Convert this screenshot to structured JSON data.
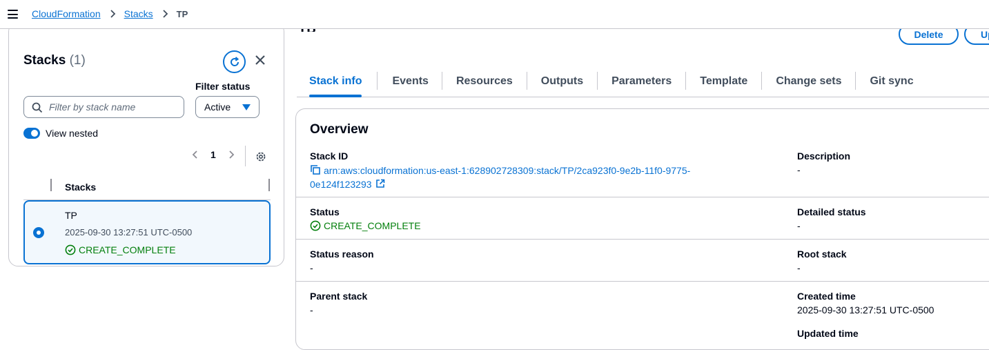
{
  "breadcrumb": {
    "items": [
      "CloudFormation",
      "Stacks"
    ],
    "current": "TP"
  },
  "left": {
    "title": "Stacks",
    "count": "(1)",
    "filter_label": "Filter status",
    "filter_value": "Active",
    "search_placeholder": "Filter by stack name",
    "toggle_label": "View nested",
    "page": "1",
    "column_header": "Stacks",
    "rows": [
      {
        "name": "TP",
        "created": "2025-09-30 13:27:51 UTC-0500",
        "status": "CREATE_COMPLETE"
      }
    ]
  },
  "detail": {
    "title_fragment": "TP",
    "delete_label": "Delete",
    "update_label": "Update",
    "tabs": [
      "Stack info",
      "Events",
      "Resources",
      "Outputs",
      "Parameters",
      "Template",
      "Change sets",
      "Git sync"
    ],
    "active_tab": "Stack info",
    "overview": {
      "title": "Overview",
      "stack_id_label": "Stack ID",
      "stack_id_line1": "arn:aws:cloudformation:us-east-1:628902728309:stack/TP/2ca923f0-9e2b-11f0-9775-",
      "stack_id_line2": "0e124f123293",
      "description_label": "Description",
      "description_value": "-",
      "status_label": "Status",
      "status_value": "CREATE_COMPLETE",
      "detailed_status_label": "Detailed status",
      "detailed_status_value": "-",
      "status_reason_label": "Status reason",
      "status_reason_value": "-",
      "root_stack_label": "Root stack",
      "root_stack_value": "-",
      "parent_stack_label": "Parent stack",
      "parent_stack_value": "-",
      "created_time_label": "Created time",
      "created_time_value": "2025-09-30 13:27:51 UTC-0500",
      "updated_time_label": "Updated time"
    }
  },
  "colors": {
    "link": "#0972d3",
    "success": "#037f0c",
    "border": "#c6c6cd"
  }
}
